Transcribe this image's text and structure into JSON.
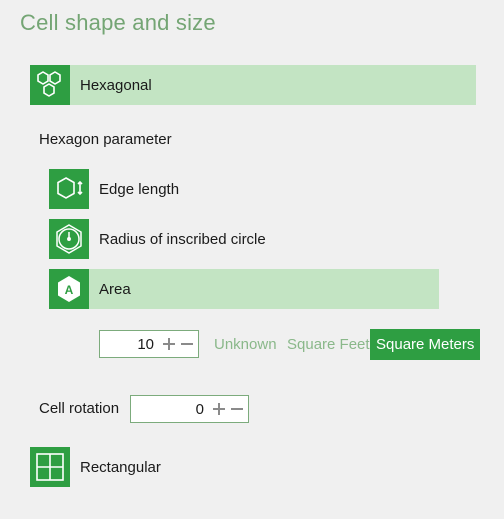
{
  "page": {
    "title": "Cell shape and size"
  },
  "shapes": {
    "hexagonal": {
      "label": "Hexagonal",
      "icon": "hexagon-cluster-icon",
      "selected": true
    },
    "rectangular": {
      "label": "Rectangular",
      "icon": "grid-icon",
      "selected": false
    }
  },
  "hexagon_parameter": {
    "heading": "Hexagon parameter",
    "options": [
      {
        "label": "Edge length",
        "icon": "hexagon-edge-icon",
        "selected": false
      },
      {
        "label": "Radius of inscribed circle",
        "icon": "hexagon-inscribed-circle-icon",
        "selected": false
      },
      {
        "label": "Area",
        "icon": "hexagon-area-icon",
        "icon_letter": "A",
        "selected": true
      }
    ]
  },
  "area": {
    "value": "10",
    "units": [
      {
        "label": "Unknown",
        "active": false
      },
      {
        "label": "Square Feet",
        "active": false
      },
      {
        "label": "Square Meters",
        "active": true
      }
    ]
  },
  "rotation": {
    "label": "Cell rotation",
    "value": "0"
  },
  "colors": {
    "accent": "#2e9e42",
    "selected_row": "#c3e4c3",
    "title": "#74a574",
    "inactive_unit": "#8ab88a",
    "background": "#f0f0f0"
  }
}
